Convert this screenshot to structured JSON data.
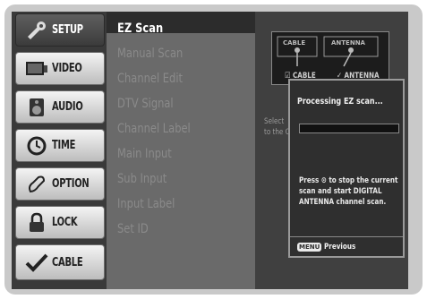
{
  "tabs": [
    {
      "label": "SETUP",
      "icon": "setup-icon"
    },
    {
      "label": "VIDEO",
      "icon": "video-icon"
    },
    {
      "label": "AUDIO",
      "icon": "audio-icon"
    },
    {
      "label": "TIME",
      "icon": "time-icon"
    },
    {
      "label": "OPTION",
      "icon": "option-icon"
    },
    {
      "label": "LOCK",
      "icon": "lock-icon"
    },
    {
      "label": "CABLE",
      "icon": "cable-icon"
    }
  ],
  "menu": {
    "items": [
      "EZ Scan",
      "Manual Scan",
      "Channel Edit",
      "DTV Signal",
      "Channel Label",
      "Main Input",
      "Sub Input",
      "Input Label",
      "Set ID"
    ]
  },
  "antenna": {
    "cable_caption": "CABLE",
    "antenna_caption": "ANTENNA",
    "cable_option": "CABLE",
    "antenna_option": "ANTENNA"
  },
  "side_text": {
    "line1": "Select",
    "line2": "to the C"
  },
  "panel": {
    "title": "Processing EZ scan...",
    "progress": 0.0,
    "message": "Press ⊙ to stop the current scan and start DIGITAL ANTENNA channel scan.",
    "menu_key": "MENU",
    "previous": "Previous"
  },
  "colors": {
    "active_tab": "#4a4a4a",
    "inactive_tab": "#d6d6d6",
    "menu_bg": "#6a6a6a",
    "panel_bg": "#2f2f2f"
  }
}
